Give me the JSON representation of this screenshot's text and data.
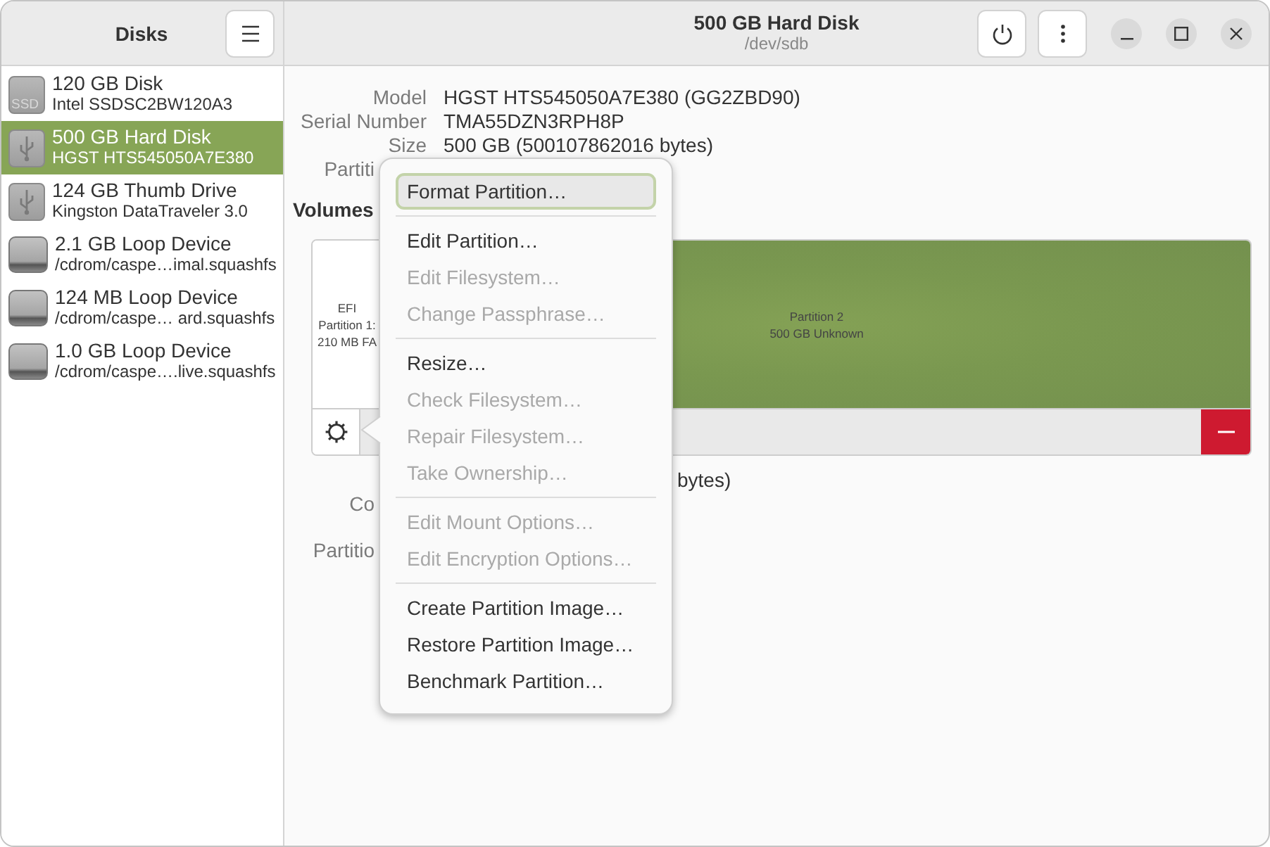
{
  "sidebar": {
    "title": "Disks",
    "items": [
      {
        "kind": "ssd",
        "icon_text": "SSD",
        "name": "120 GB Disk",
        "detail": "Intel SSDSC2BW120A3",
        "selected": false
      },
      {
        "kind": "usb",
        "name": "500 GB Hard Disk",
        "detail": "HGST HTS545050A7E380",
        "selected": true
      },
      {
        "kind": "usb",
        "name": "124 GB Thumb Drive",
        "detail": "Kingston DataTraveler 3.0",
        "selected": false
      },
      {
        "kind": "loop",
        "name": "2.1 GB Loop Device",
        "detail": "/cdrom/caspe…imal.squashfs",
        "selected": false
      },
      {
        "kind": "loop",
        "name": "124 MB Loop Device",
        "detail": "/cdrom/caspe… ard.squashfs",
        "selected": false
      },
      {
        "kind": "loop",
        "name": "1.0 GB Loop Device",
        "detail": "/cdrom/caspe….live.squashfs",
        "selected": false
      }
    ]
  },
  "header": {
    "title": "500 GB Hard Disk",
    "subtitle": "/dev/sdb"
  },
  "drive_properties": [
    {
      "label": "Model",
      "value": "HGST HTS545050A7E380 (GG2ZBD90)"
    },
    {
      "label": "Serial Number",
      "value": "TMA55DZN3RPH8P"
    },
    {
      "label": "Size",
      "value": "500 GB (500107862016 bytes)"
    },
    {
      "label": "Partiti"
    }
  ],
  "volumes": {
    "title": "Volumes",
    "partitions": [
      {
        "lines": [
          "EFI",
          "Partition 1:",
          "210 MB FA"
        ],
        "selected": false
      },
      {
        "lines": [
          "Partition 2",
          "500 GB Unknown"
        ],
        "selected": true
      }
    ]
  },
  "partition_properties": [
    {
      "value": "bytes)"
    },
    {
      "label": "Co"
    },
    {
      "label": "Partitio"
    }
  ],
  "menu": {
    "sections": [
      [
        {
          "label": "Format Partition…",
          "disabled": false,
          "highlighted": true
        }
      ],
      [
        {
          "label": "Edit Partition…",
          "disabled": false,
          "highlighted": false
        },
        {
          "label": "Edit Filesystem…",
          "disabled": true,
          "highlighted": false
        },
        {
          "label": "Change Passphrase…",
          "disabled": true,
          "highlighted": false
        }
      ],
      [
        {
          "label": "Resize…",
          "disabled": false,
          "highlighted": false
        },
        {
          "label": "Check Filesystem…",
          "disabled": true,
          "highlighted": false
        },
        {
          "label": "Repair Filesystem…",
          "disabled": true,
          "highlighted": false
        },
        {
          "label": "Take Ownership…",
          "disabled": true,
          "highlighted": false
        }
      ],
      [
        {
          "label": "Edit Mount Options…",
          "disabled": true,
          "highlighted": false
        },
        {
          "label": "Edit Encryption Options…",
          "disabled": true,
          "highlighted": false
        }
      ],
      [
        {
          "label": "Create Partition Image…",
          "disabled": false,
          "highlighted": false
        },
        {
          "label": "Restore Partition Image…",
          "disabled": false,
          "highlighted": false
        },
        {
          "label": "Benchmark Partition…",
          "disabled": false,
          "highlighted": false
        }
      ]
    ]
  }
}
